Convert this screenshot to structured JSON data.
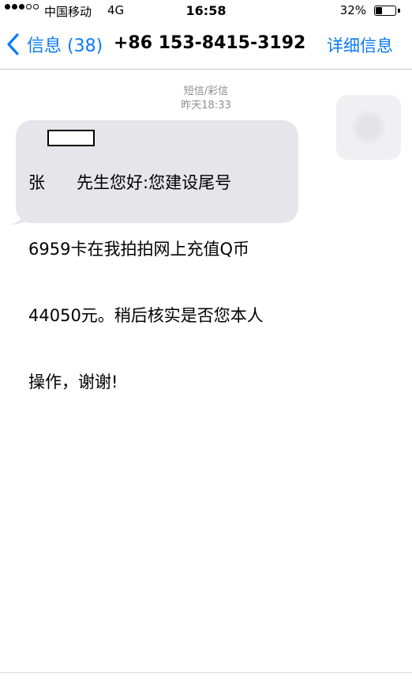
{
  "status_bar": {
    "signal_bars_filled": 3,
    "signal_bars_total": 5,
    "carrier": "中国移动",
    "network": "4G",
    "time": "16:58",
    "battery_percent_label": "32%",
    "battery_level": 0.32
  },
  "nav": {
    "back_label": "信息 (38)",
    "title": "+86 153-8415-3192",
    "details_label": "详细信息",
    "accent_color": "#0a7bf5"
  },
  "conversation": {
    "message_type": "短信/彩信",
    "timestamp": "昨天18:33",
    "message": {
      "line1": "张      先生您好:您建设尾号",
      "line2": "6959卡在我拍拍网上充值Q币",
      "line3": "44050元。稍后核实是否您本人",
      "line4": "操作，谢谢!"
    },
    "bubble_color": "#e5e5ea"
  }
}
